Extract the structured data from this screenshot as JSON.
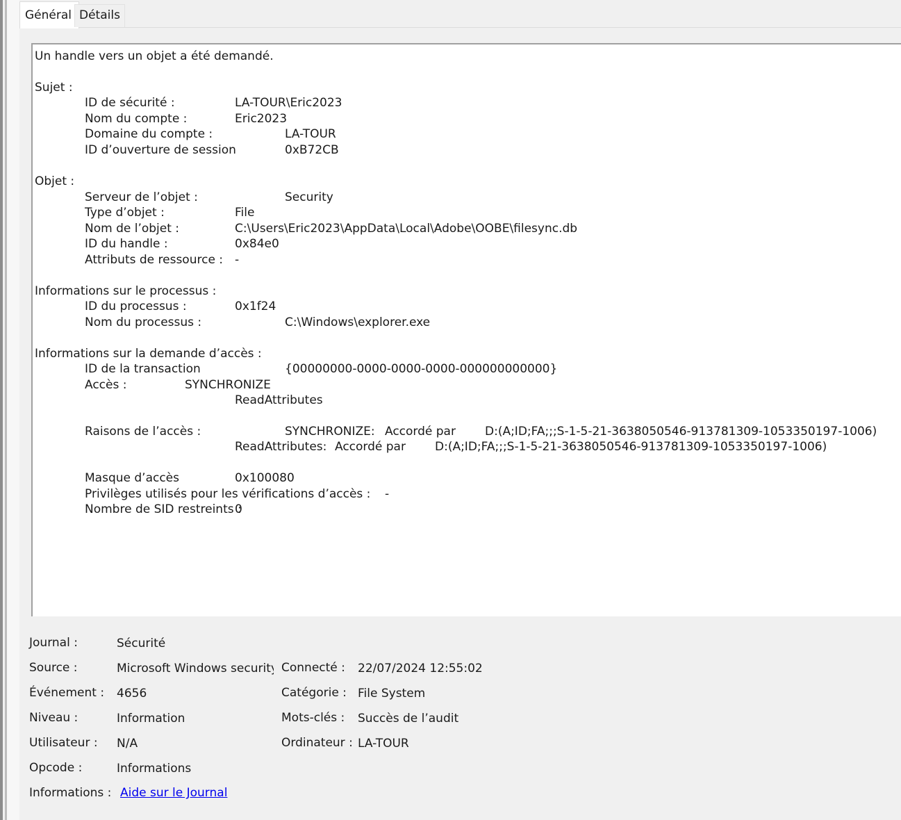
{
  "tabs": {
    "general": "Général",
    "details": "Détails"
  },
  "description": {
    "intro": "Un handle vers un objet a été demandé.",
    "subject": {
      "heading": "Sujet :",
      "security_id_label": "ID de sécurité :",
      "security_id": "LA-TOUR\\Eric2023",
      "account_name_label": "Nom du compte :",
      "account_name": "Eric2023",
      "account_domain_label": "Domaine du compte :",
      "account_domain": "LA-TOUR",
      "logon_id_label": "ID d’ouverture de session",
      "logon_id": "0xB72CB"
    },
    "object": {
      "heading": "Objet :",
      "server_label": "Serveur de l’objet :",
      "server": "Security",
      "type_label": "Type d’objet :",
      "type": "File",
      "name_label": "Nom de l’objet :",
      "name": "C:\\Users\\Eric2023\\AppData\\Local\\Adobe\\OOBE\\filesync.db",
      "handle_label": "ID du handle :",
      "handle": "0x84e0",
      "attributes_label": "Attributs de ressource :",
      "attributes": "-"
    },
    "process": {
      "heading": "Informations sur le processus :",
      "id_label": "ID du processus :",
      "id": "0x1f24",
      "name_label": "Nom du processus :",
      "name": "C:\\Windows\\explorer.exe"
    },
    "access": {
      "heading": "Informations sur la demande d’accès :",
      "transaction_label": "ID de la transaction",
      "transaction": "{00000000-0000-0000-0000-000000000000}",
      "access_label": "Accès :",
      "access_1": "SYNCHRONIZE",
      "access_2": "ReadAttributes",
      "reasons_label": "Raisons de l’accès :",
      "reason_1_right": "SYNCHRONIZE:",
      "reason_1_granted": "Accordé par",
      "reason_1_sddl": "D:(A;ID;FA;;;S-1-5-21-3638050546-913781309-1053350197-1006)",
      "reason_2_right": "ReadAttributes:",
      "reason_2_granted": "Accordé par",
      "reason_2_sddl": "D:(A;ID;FA;;;S-1-5-21-3638050546-913781309-1053350197-1006)",
      "mask_label": "Masque d’accès",
      "mask": "0x100080",
      "privileges_label": "Privilèges utilisés pour les vérifications d’accès :",
      "privileges": "-",
      "restricted_sid_label": "Nombre de SID restreints :",
      "restricted_sid": "0"
    }
  },
  "meta": {
    "journal_label": "Journal :",
    "journal": "Sécurité",
    "source_label": "Source :",
    "source": "Microsoft Windows security auditing.",
    "connected_label": "Connecté :",
    "connected": "22/07/2024 12:55:02",
    "event_label": "Événement :",
    "event": "4656",
    "category_label": "Catégorie :",
    "category": "File System",
    "level_label": "Niveau :",
    "level": "Information",
    "keywords_label": "Mots-clés :",
    "keywords": "Succès de l’audit",
    "user_label": "Utilisateur :",
    "user": "N/A",
    "computer_label": "Ordinateur :",
    "computer": "LA-TOUR",
    "opcode_label": "Opcode :",
    "opcode": "Informations",
    "info_label": "Informations :",
    "info_link": "Aide sur le Journal"
  }
}
